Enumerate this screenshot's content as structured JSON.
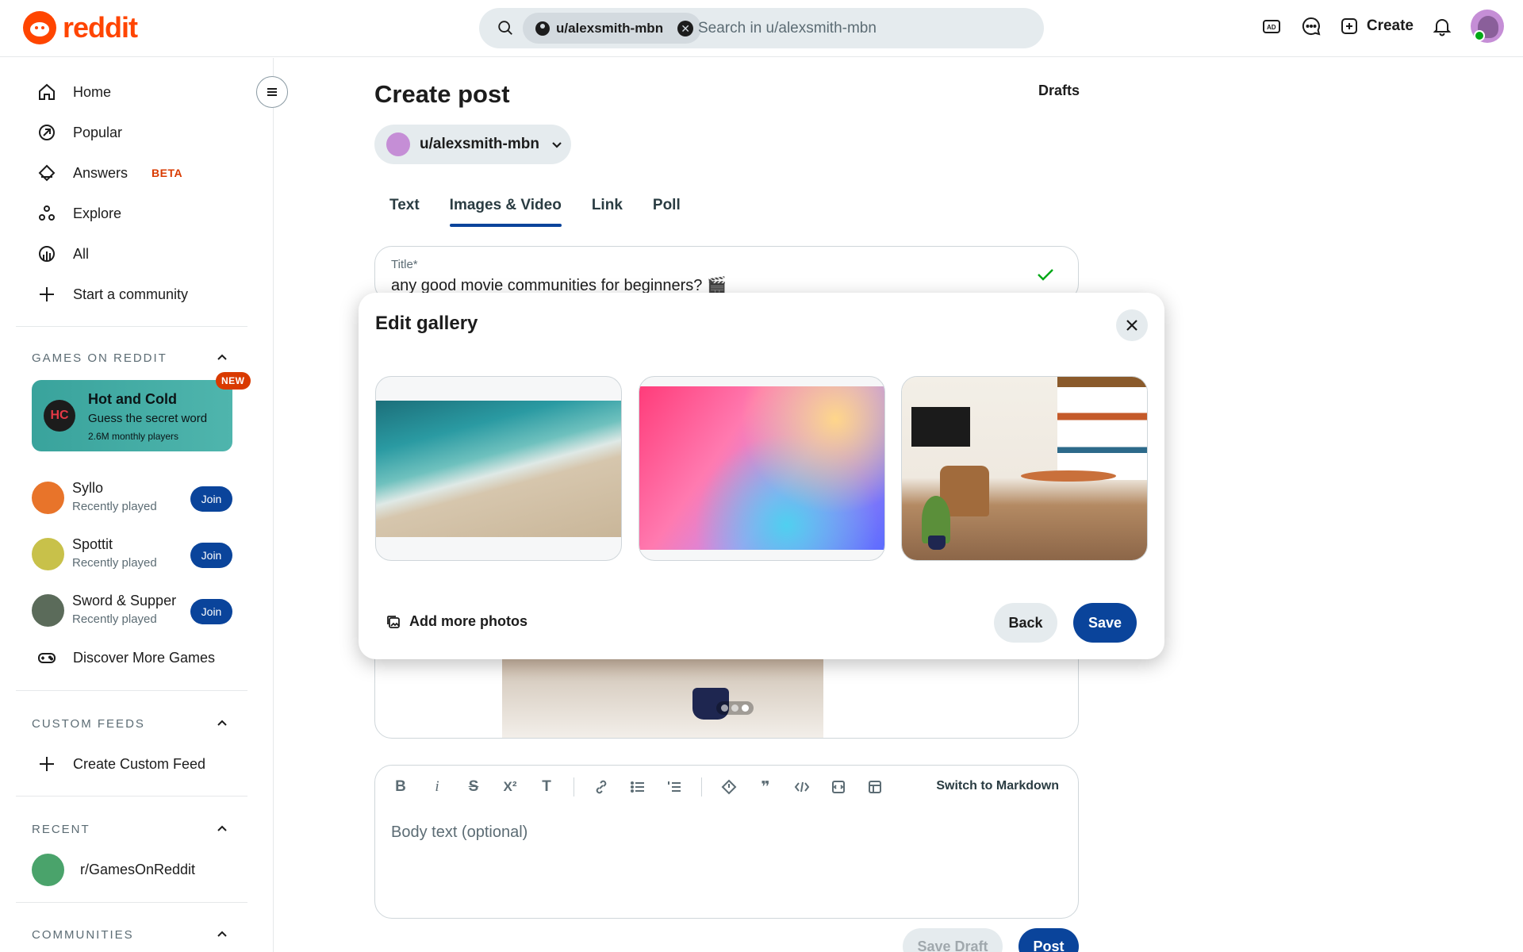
{
  "header": {
    "logo_text": "reddit",
    "search": {
      "chip_label": "u/alexsmith-mbn",
      "placeholder": "Search in u/alexsmith-mbn"
    },
    "create_label": "Create"
  },
  "sidebar": {
    "nav": [
      {
        "label": "Home",
        "icon": "home-icon"
      },
      {
        "label": "Popular",
        "icon": "popular-icon"
      },
      {
        "label": "Answers",
        "icon": "answers-icon",
        "badge": "BETA"
      },
      {
        "label": "Explore",
        "icon": "explore-icon"
      },
      {
        "label": "All",
        "icon": "all-icon"
      },
      {
        "label": "Start a community",
        "icon": "plus-icon"
      }
    ],
    "games_section": "GAMES ON REDDIT",
    "featured_game": {
      "badge": "NEW",
      "title": "Hot and Cold",
      "subtitle": "Guess the secret word",
      "players": "2.6M monthly players"
    },
    "games": [
      {
        "name": "Syllo",
        "meta": "Recently played",
        "join": "Join",
        "color": "#e8742a"
      },
      {
        "name": "Spottit",
        "meta": "Recently played",
        "join": "Join",
        "color": "#c8c14a"
      },
      {
        "name": "Sword & Supper",
        "meta": "Recently played",
        "join": "Join",
        "color": "#5b6b5a"
      }
    ],
    "discover_games": "Discover More Games",
    "custom_feeds_section": "CUSTOM FEEDS",
    "create_custom_feed": "Create Custom Feed",
    "recent_section": "RECENT",
    "recent_items": [
      {
        "label": "r/GamesOnReddit"
      }
    ],
    "communities_section": "COMMUNITIES"
  },
  "main": {
    "title": "Create post",
    "drafts": "Drafts",
    "user_select": "u/alexsmith-mbn",
    "tabs": [
      {
        "label": "Text",
        "active": false
      },
      {
        "label": "Images & Video",
        "active": true
      },
      {
        "label": "Link",
        "active": false
      },
      {
        "label": "Poll",
        "active": false
      }
    ],
    "title_field": {
      "label": "Title*",
      "value": "any good movie communities for beginners? 🎬"
    },
    "editor": {
      "switch_markdown": "Switch to Markdown",
      "body_placeholder": "Body text (optional)"
    },
    "save_draft": "Save Draft",
    "post": "Post"
  },
  "modal": {
    "title": "Edit gallery",
    "add_more": "Add more photos",
    "back": "Back",
    "save": "Save"
  },
  "colors": {
    "brand": "#ff4500",
    "primary_button": "#0a449b",
    "secondary_button": "#e5ebee"
  }
}
